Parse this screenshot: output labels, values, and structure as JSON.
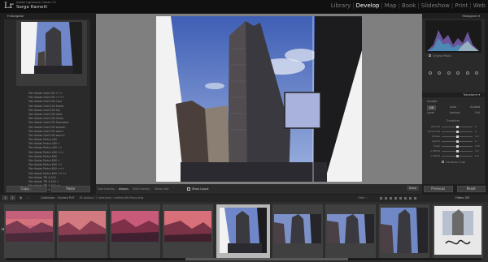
{
  "app": {
    "logo": "Lr",
    "identity_line1": "Adobe Lightroom Classic CC",
    "identity_line2": "Serge Ramelli"
  },
  "modules": [
    "Library",
    "Develop",
    "Map",
    "Book",
    "Slideshow",
    "Print",
    "Web"
  ],
  "active_module": "Develop",
  "navigator": {
    "title": "Navigator"
  },
  "presets": [
    "Film Kodak Gold 200 +++",
    "Film Kodak Gold 200 ++++",
    "Film Kodak Gold 200 Cool",
    "Film Kodak Gold 200 Faded",
    "Film Kodak Gold 200 Fuji",
    "Film Kodak Gold 200 Gold",
    "Film Kodak Gold 200 Green",
    "Film Kodak Gold 200 Saturated",
    "Film Kodak Gold 200 smooth",
    "Film Kodak Gold 200 warm",
    "Film Kodak Gold 200 warm+",
    "Film Kodak Portra 400",
    "Film Kodak Portra 400 +",
    "Film Kodak Portra 400 ++",
    "Film Kodak Portra 400 +++",
    "Film Kodak Portra 800",
    "Film Kodak Portra 800 +",
    "Film Kodak Portra 800 ++",
    "Film Kodak Portra 800 +++",
    "Film Kodak Portra 800 ++++",
    "Film Kodak TRI X 400",
    "Film Kodak TRI X 400 +",
    "Film Kodak TRI X 400 ++",
    "Film Kodak TRI X 400 +++"
  ],
  "left_buttons": {
    "copy": "Copy...",
    "paste": "Paste"
  },
  "right_buttons": {
    "previous": "Previous",
    "reset": "Reset"
  },
  "toolbar": {
    "tool_overlay_label": "Tool Overlay :",
    "tool_overlay_value": "Always",
    "grid_label": "Grid Overlay",
    "show_grid_label": "Show Grid",
    "loupe_label": "Show Loupe",
    "done": "Done"
  },
  "right_panel": {
    "histogram_title": "Histogram",
    "original_photo": "Original Photo",
    "transform_title": "Transform",
    "upright_tabs": [
      "Off",
      "Auto",
      "Guided"
    ],
    "upright_tabs2": [
      "Level",
      "Vertical",
      "Full"
    ],
    "upright_title": "Upright",
    "transform_sub": "Transform",
    "crop_note": "Built-in Lens Profile Applied",
    "sliders": [
      {
        "label": "Vertical",
        "value": "0"
      },
      {
        "label": "Horizontal",
        "value": "0"
      },
      {
        "label": "Rotate",
        "value": "0.0"
      },
      {
        "label": "Aspect",
        "value": "0"
      },
      {
        "label": "Scale",
        "value": "100"
      },
      {
        "label": "X Offset",
        "value": "0.0"
      },
      {
        "label": "Y Offset",
        "value": "0.0"
      }
    ],
    "constrain_crop": "Constrain Crop"
  },
  "filmstrip": {
    "page1": "1",
    "page2": "2",
    "collection": "Collection : Current PLP",
    "count": "18 photos / 1 selected / untitled-66-Pano.dng",
    "filter_label": "Filter :",
    "filter_value": "Filters Off"
  },
  "colors": {
    "accent": "#ffffff",
    "panel": "#2a2a2a",
    "background": "#1e1e1e",
    "canvas": "#7f7f7f",
    "sky": "#6f86c9"
  }
}
